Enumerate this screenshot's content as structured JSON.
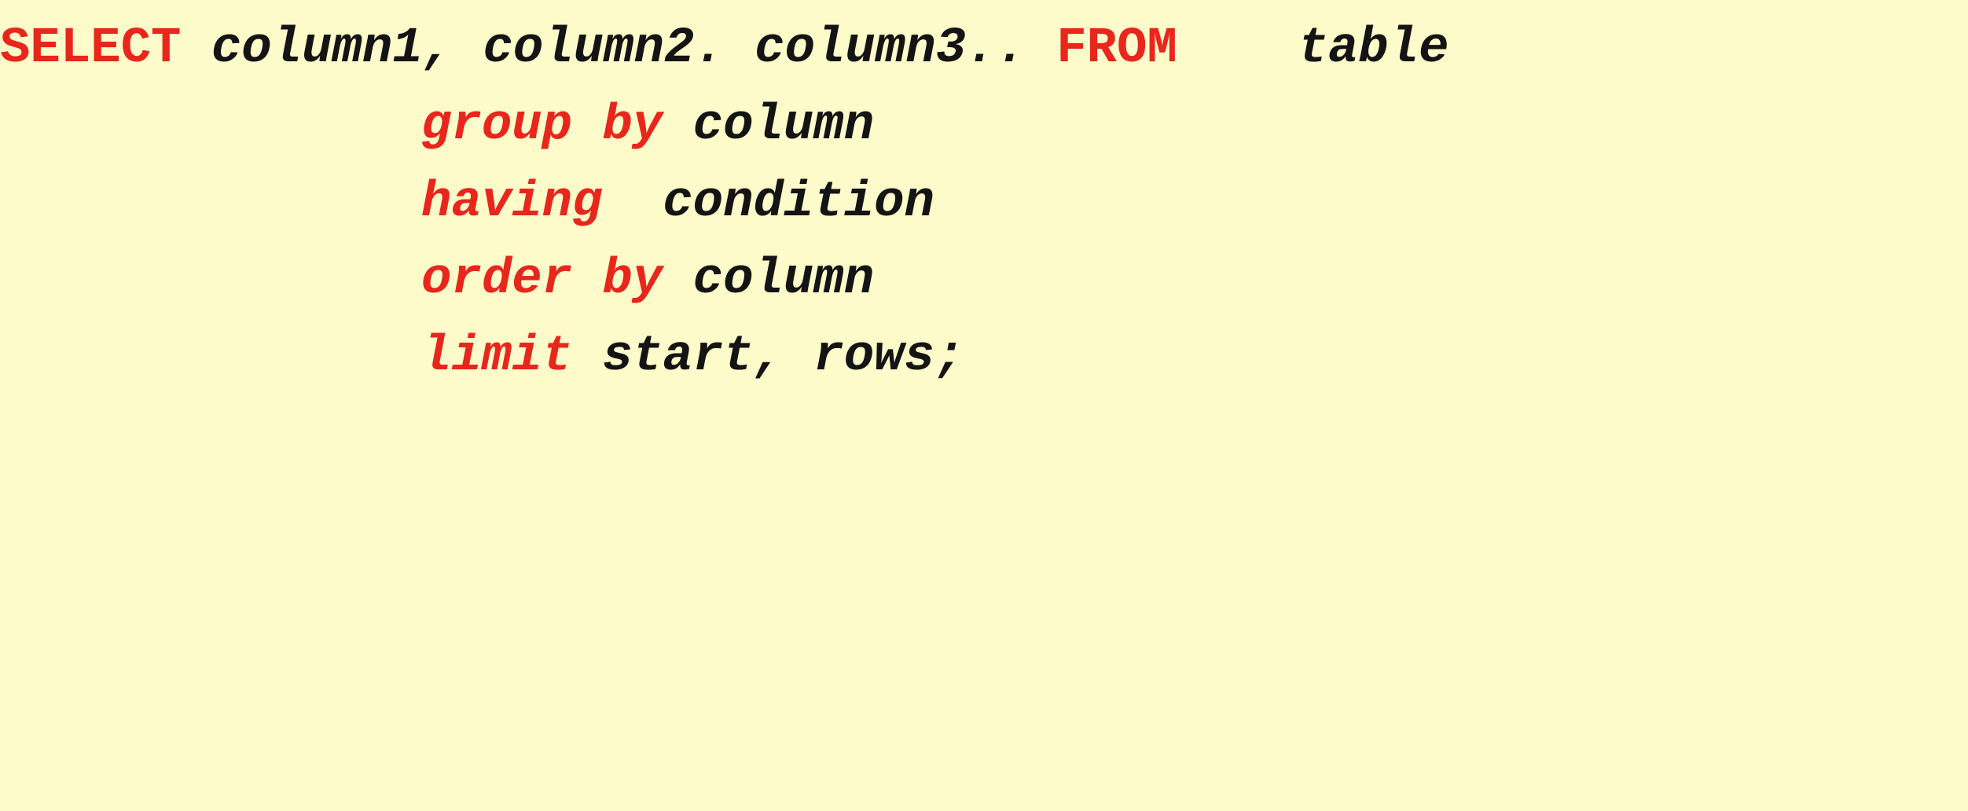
{
  "query": {
    "line1": {
      "select_kw": "SELECT",
      "columns": " column1, column2. column3.. ",
      "from_kw": "FROM",
      "gap": "    ",
      "table": "table"
    },
    "line2": {
      "keyword": "group by",
      "value": " column"
    },
    "line3": {
      "keyword": "having",
      "value": "  condition"
    },
    "line4": {
      "keyword": "order by",
      "value": " column"
    },
    "line5": {
      "keyword": "limit",
      "value": " start, rows;"
    }
  },
  "colors": {
    "background": "#fdfbca",
    "keyword": "#e8261c",
    "text": "#141414"
  }
}
